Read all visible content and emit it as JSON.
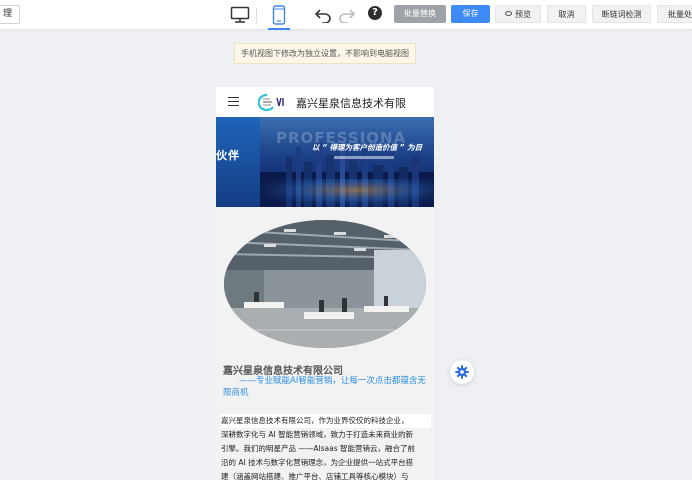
{
  "toolbar": {
    "left_box_text": "理",
    "buttons": {
      "batch_replace": "批量替换",
      "save": "保存",
      "preview": "预览",
      "cancel": "取消",
      "broken_link_check": "断链词检测",
      "batch_action": "批量处"
    },
    "help_label": "?"
  },
  "notice": "手机视图下修改为独立设置，不影响到电脑视图",
  "mobile": {
    "company_name": "嘉兴星泉信息技术有限",
    "banner": {
      "partner_text": "伙伴",
      "big_text": "PROFESSIONA",
      "slogan": "以 “ 得理为客户创造价值 ” 为目"
    },
    "company_title": "嘉兴星泉信息技术有限公司",
    "company_slogan": "——专业赋能AI智能营销，让每一次点击都蕴含无限商机",
    "intro_lines": [
      "嘉兴星泉信息技术有限公司，作为业界佼佼的科技企业，",
      "深耕数字化与 AI 智能营销领域，致力于打造未来商业的新",
      "引擎。我们的明星产品 ——Alsaas 智能营销云，融合了前",
      "沿的 AI 技术与数字化营销理念，为企业提供一站式平台搭",
      "建（涵盖网站搭建、推广平台、店铺工具等核心模块）与"
    ]
  },
  "colors": {
    "accent_blue": "#3e8af7",
    "slogan_blue": "#2b8fe5",
    "notice_bg": "#fcf7e8"
  },
  "icons": [
    "desktop-icon",
    "mobile-icon",
    "undo-icon",
    "redo-icon",
    "help-icon",
    "eye-icon",
    "hamburger-icon",
    "logo-icon",
    "gear-icon"
  ]
}
